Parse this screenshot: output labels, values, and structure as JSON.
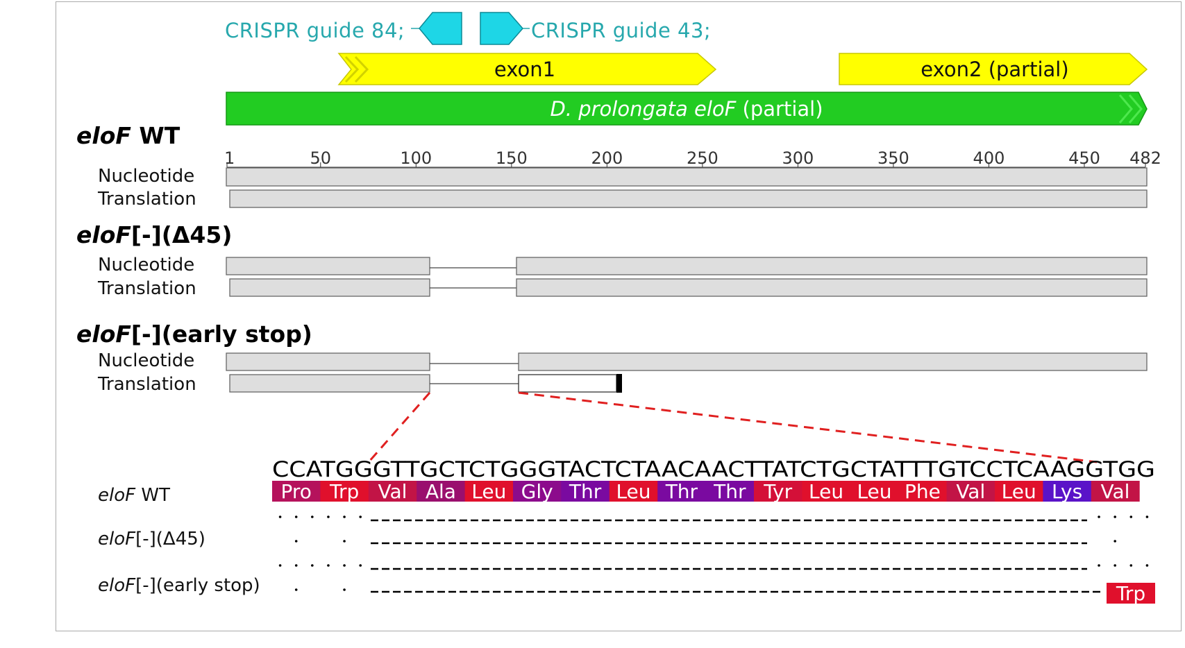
{
  "annotations": {
    "guide84": "CRISPR guide 84;",
    "guide43": "CRISPR guide 43;",
    "exon1": "exon1",
    "exon2": "exon2 (partial)",
    "gene_italic": "D. prolongata eloF",
    "gene_suffix": " (partial)",
    "colors": {
      "guide": "#22c8d6",
      "guide_text": "#27a8ad",
      "exon": "#ffff00",
      "gene": "#22cc22"
    }
  },
  "scale": {
    "ticks": [
      "1",
      "50",
      "100",
      "150",
      "200",
      "250",
      "300",
      "350",
      "400",
      "450",
      "482"
    ],
    "start": 1,
    "end": 482
  },
  "rows": {
    "nucleotide": "Nucleotide",
    "translation": "Translation"
  },
  "tracks": [
    {
      "name_italic": "eloF",
      "name_rest": " WT"
    },
    {
      "name_italic": "eloF",
      "name_rest": "[-](Δ45)"
    },
    {
      "name_italic": "eloF",
      "name_rest": "[-](early stop)"
    }
  ],
  "alignment": {
    "sequence": "CCATGGGTTGCTCTGGGTACTCTAACAACTTATCTGCTATTTGTCCTCAAGGTGG",
    "row_labels": [
      {
        "italic": "eloF",
        "rest": " WT"
      },
      {
        "italic": "eloF",
        "rest": "[-](Δ45)"
      },
      {
        "italic": "eloF",
        "rest": "[-](early stop)"
      }
    ],
    "amino_acids": [
      {
        "name": "Pro",
        "color": "#b5125c"
      },
      {
        "name": "Trp",
        "color": "#e0102c"
      },
      {
        "name": "Val",
        "color": "#c21446"
      },
      {
        "name": "Ala",
        "color": "#9a0f6e"
      },
      {
        "name": "Leu",
        "color": "#e0102c"
      },
      {
        "name": "Gly",
        "color": "#8c0b8c"
      },
      {
        "name": "Thr",
        "color": "#7a0aa0"
      },
      {
        "name": "Leu",
        "color": "#e0102c"
      },
      {
        "name": "Thr",
        "color": "#7a0aa0"
      },
      {
        "name": "Thr",
        "color": "#7a0aa0"
      },
      {
        "name": "Tyr",
        "color": "#d41038"
      },
      {
        "name": "Leu",
        "color": "#e0102c"
      },
      {
        "name": "Leu",
        "color": "#e0102c"
      },
      {
        "name": "Phe",
        "color": "#e0102c"
      },
      {
        "name": "Val",
        "color": "#c21446"
      },
      {
        "name": "Leu",
        "color": "#e0102c"
      },
      {
        "name": "Lys",
        "color": "#5a13c8"
      },
      {
        "name": "Val",
        "color": "#c21446"
      }
    ],
    "stop_residue": {
      "name": "Trp",
      "color": "#e0102c"
    }
  }
}
